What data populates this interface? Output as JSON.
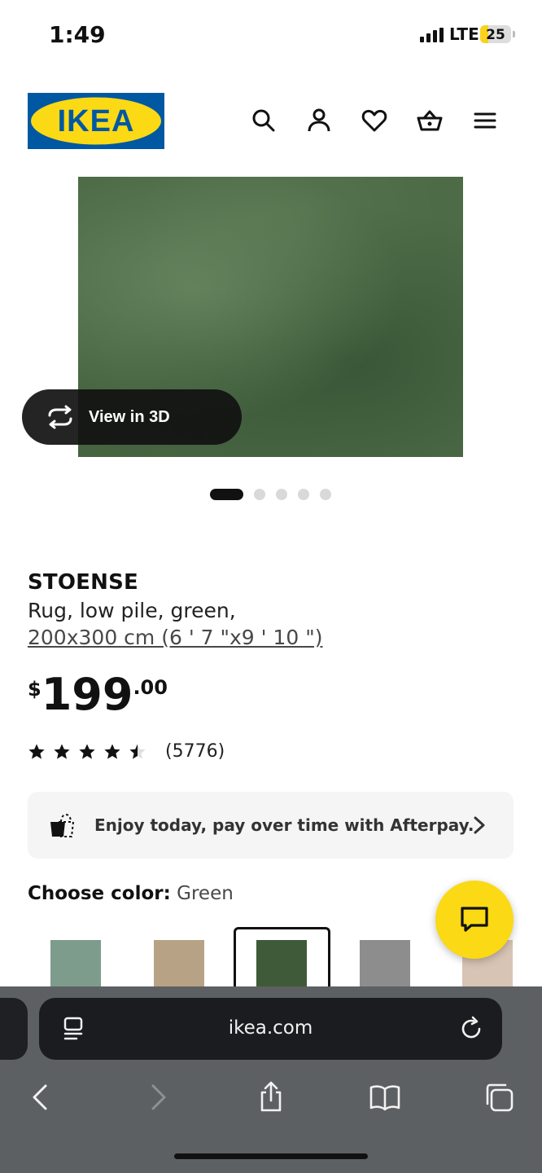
{
  "status_bar": {
    "time": "1:49",
    "network": "LTE",
    "battery": "25",
    "battery_fraction": 0.25
  },
  "header": {
    "logo_text": "IKEA",
    "icons": [
      "search-icon",
      "account-icon",
      "heart-icon",
      "basket-icon",
      "menu-icon"
    ]
  },
  "gallery": {
    "view_3d_label": "View in 3D",
    "dot_count": 5,
    "active_dot": 1
  },
  "product": {
    "name": "STOENSE",
    "description": "Rug, low pile, green,",
    "size": "200x300 cm (6 ' 7 \"x9 ' 10 \")",
    "price_currency": "$",
    "price_int": "199",
    "price_dec": ".00",
    "rating": 4.5,
    "rating_count": "(5776)"
  },
  "afterpay": {
    "text": "Enjoy today, pay over time with Afterpay."
  },
  "color": {
    "label": "Choose color:",
    "value": "Green",
    "swatches": [
      "#7d9c8c",
      "#b7a285",
      "#3f5a38",
      "#8d8d8d",
      "#d8c4b4"
    ],
    "selected_index": 2
  },
  "browser": {
    "url": "ikea.com"
  },
  "colors": {
    "ikea_blue": "#0058a3",
    "ikea_yellow": "#fbd914",
    "text_dark": "#111111"
  }
}
